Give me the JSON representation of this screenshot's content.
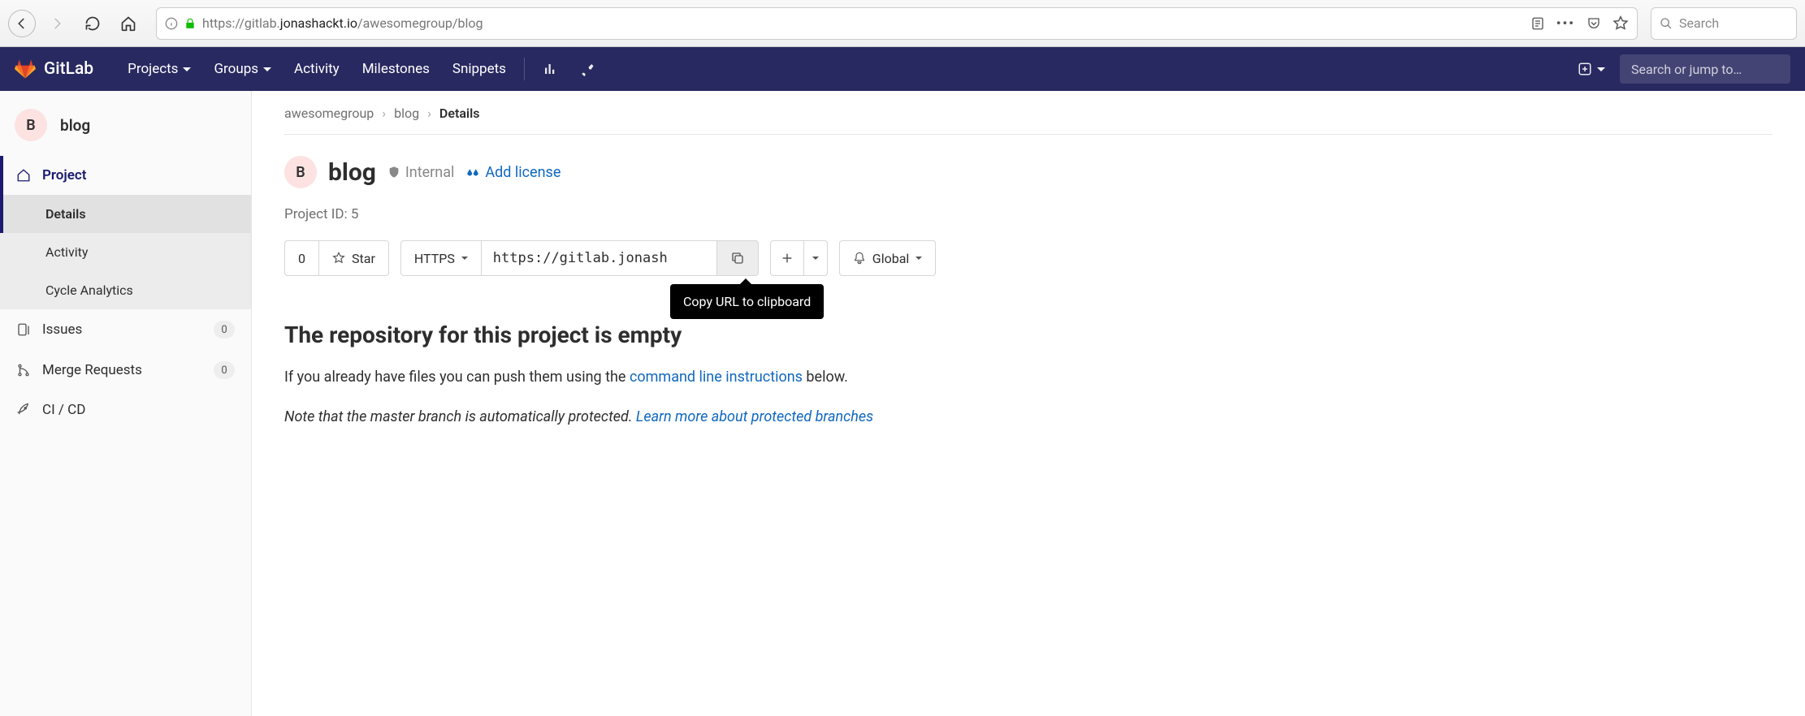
{
  "browser": {
    "url_prefix": "https://",
    "url_host": "gitlab.",
    "url_dark": "jonashackt.io",
    "url_suffix": "/awesomegroup/blog",
    "search_placeholder": "Search"
  },
  "topnav": {
    "brand": "GitLab",
    "items": [
      "Projects",
      "Groups",
      "Activity",
      "Milestones",
      "Snippets"
    ],
    "search_placeholder": "Search or jump to…"
  },
  "sidebar": {
    "avatar_letter": "B",
    "project_title": "blog",
    "project_label": "Project",
    "sub": [
      "Details",
      "Activity",
      "Cycle Analytics"
    ],
    "issues": {
      "label": "Issues",
      "count": "0"
    },
    "merge": {
      "label": "Merge Requests",
      "count": "0"
    },
    "cicd": {
      "label": "CI / CD"
    }
  },
  "crumbs": {
    "group": "awesomegroup",
    "project": "blog",
    "page": "Details"
  },
  "project": {
    "avatar_letter": "B",
    "name": "blog",
    "visibility": "Internal",
    "license_link": "Add license",
    "id_label": "Project ID: 5"
  },
  "actions": {
    "star_count": "0",
    "star_label": "Star",
    "protocol": "HTTPS",
    "url_value": "https://gitlab.jonash",
    "copy_tooltip": "Copy URL to clipboard",
    "notify": "Global"
  },
  "empty": {
    "title": "The repository for this project is empty",
    "body_pre": "If you already have files you can push them using the ",
    "body_link": "command line instructions",
    "body_post": " below.",
    "note_pre": "Note that the master branch is automatically protected. ",
    "note_link": "Learn more about protected branches"
  }
}
